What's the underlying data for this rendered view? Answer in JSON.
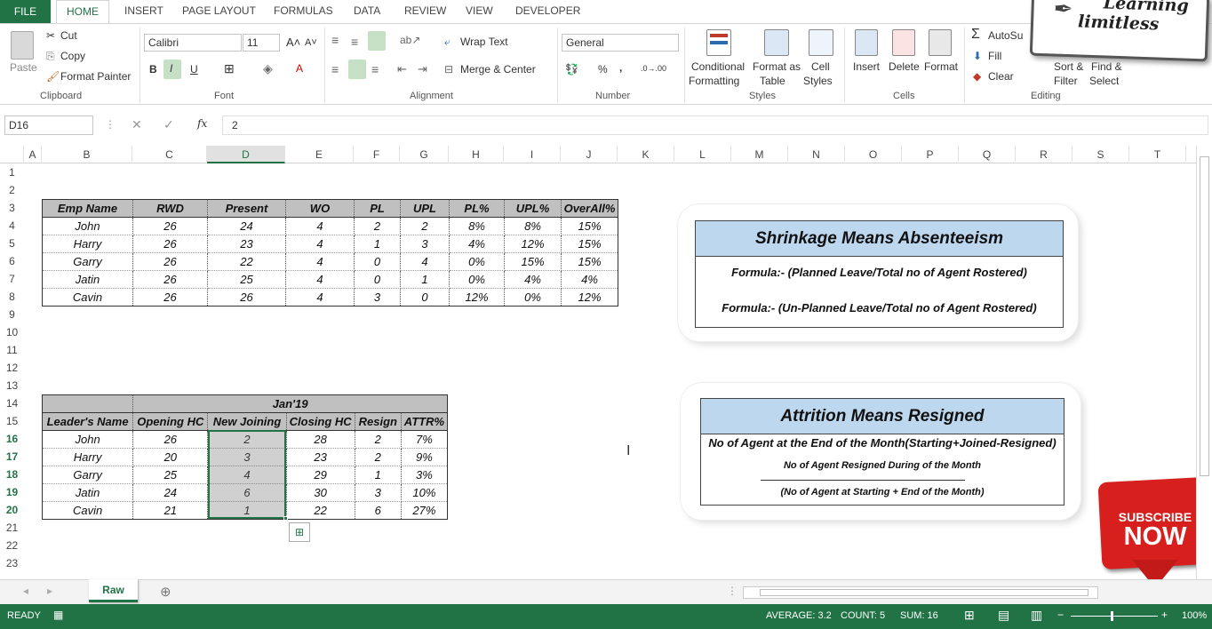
{
  "tabs": {
    "file": "FILE",
    "items": [
      "HOME",
      "INSERT",
      "PAGE LAYOUT",
      "FORMULAS",
      "DATA",
      "REVIEW",
      "VIEW",
      "DEVELOPER"
    ]
  },
  "ribbon": {
    "clipboard": {
      "paste": "Paste",
      "cut": "Cut",
      "copy": "Copy",
      "format_painter": "Format Painter",
      "label": "Clipboard"
    },
    "font": {
      "name": "Calibri",
      "size": "11",
      "label": "Font",
      "bold": "B",
      "italic": "I",
      "underline": "U"
    },
    "alignment": {
      "wrap": "Wrap Text",
      "merge": "Merge & Center",
      "label": "Alignment"
    },
    "number": {
      "format": "General",
      "percent": "%",
      "comma": ",",
      "label": "Number"
    },
    "styles": {
      "conditional": "Conditional",
      "conditional2": "Formatting",
      "format_as": "Format as",
      "format_as2": "Table",
      "cell": "Cell",
      "cell2": "Styles",
      "label": "Styles"
    },
    "cells": {
      "insert": "Insert",
      "delete": "Delete",
      "format": "Format",
      "label": "Cells"
    },
    "editing": {
      "autosum": "AutoSu",
      "fill": "Fill",
      "clear": "Clear",
      "sort": "Sort &",
      "sort2": "Filter",
      "find": "Find &",
      "find2": "Select",
      "label": "Editing"
    },
    "logo": {
      "line1": "Learning",
      "line2": "limitless"
    }
  },
  "formula_bar": {
    "name_box": "D16",
    "fx": "fx",
    "value": "2"
  },
  "columns": [
    "A",
    "B",
    "C",
    "D",
    "E",
    "F",
    "G",
    "H",
    "I",
    "J",
    "K",
    "L",
    "M",
    "N",
    "O",
    "P",
    "Q",
    "R",
    "S",
    "T"
  ],
  "rows": [
    "1",
    "2",
    "3",
    "4",
    "5",
    "6",
    "7",
    "8",
    "9",
    "10",
    "11",
    "12",
    "13",
    "14",
    "15",
    "16",
    "17",
    "18",
    "19",
    "20",
    "21",
    "22",
    "23"
  ],
  "table1": {
    "headers": [
      "Emp Name",
      "RWD",
      "Present",
      "WO",
      "PL",
      "UPL",
      "PL%",
      "UPL%",
      "OverAll%"
    ],
    "rows": [
      [
        "John",
        "26",
        "24",
        "4",
        "2",
        "2",
        "8%",
        "8%",
        "15%"
      ],
      [
        "Harry",
        "26",
        "23",
        "4",
        "1",
        "3",
        "4%",
        "12%",
        "15%"
      ],
      [
        "Garry",
        "26",
        "22",
        "4",
        "0",
        "4",
        "0%",
        "15%",
        "15%"
      ],
      [
        "Jatin",
        "26",
        "25",
        "4",
        "0",
        "1",
        "0%",
        "4%",
        "4%"
      ],
      [
        "Cavin",
        "26",
        "26",
        "4",
        "3",
        "0",
        "12%",
        "0%",
        "12%"
      ]
    ]
  },
  "table2": {
    "period": "Jan'19",
    "headers": [
      "Leader's Name",
      "Opening HC",
      "New Joining",
      "Closing HC",
      "Resign",
      "ATTR%"
    ],
    "rows": [
      [
        "John",
        "26",
        "2",
        "28",
        "2",
        "7%"
      ],
      [
        "Harry",
        "20",
        "3",
        "23",
        "2",
        "9%"
      ],
      [
        "Garry",
        "25",
        "4",
        "29",
        "1",
        "3%"
      ],
      [
        "Jatin",
        "24",
        "6",
        "30",
        "3",
        "10%"
      ],
      [
        "Cavin",
        "21",
        "1",
        "22",
        "6",
        "27%"
      ]
    ]
  },
  "card1": {
    "title": "Shrinkage Means Absenteeism",
    "line1": "Formula:- (Planned Leave/Total no of Agent Rostered)",
    "line2": "Formula:- (Un-Planned Leave/Total no of Agent Rostered)"
  },
  "card2": {
    "title": "Attrition Means Resigned",
    "line1": "No of Agent at the End of the Month(Starting+Joined-Resigned)",
    "numerator": "No of Agent Resigned During of the Month",
    "denominator": "(No of Agent at Starting + End of the Month)"
  },
  "subscribe": {
    "line1": "SUBSCRIBE",
    "line2": "NOW"
  },
  "sheet": {
    "tab": "Raw"
  },
  "status": {
    "mode": "READY",
    "average": "AVERAGE: 3.2",
    "count": "COUNT: 5",
    "sum": "SUM: 16",
    "zoom": "100%"
  },
  "colors": {
    "excel_green": "#217346",
    "header_gray": "#c0c0c0",
    "title_blue": "#bdd7ee",
    "subscribe_red": "#d7201e"
  }
}
